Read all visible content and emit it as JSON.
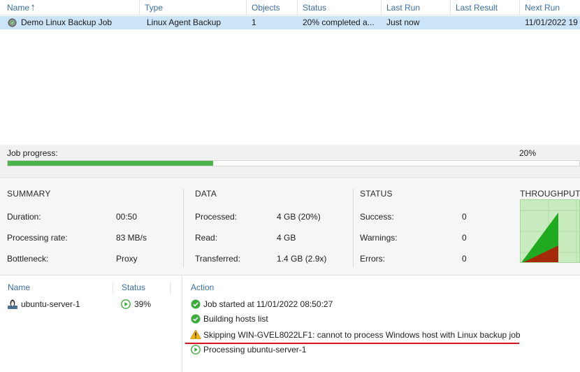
{
  "table": {
    "columns": [
      {
        "label": "Name",
        "sorted": "ascending"
      },
      {
        "label": "Type"
      },
      {
        "label": "Objects"
      },
      {
        "label": "Status"
      },
      {
        "label": "Last Run"
      },
      {
        "label": "Last Result"
      },
      {
        "label": "Next Run"
      }
    ],
    "rows": [
      {
        "name": "Demo Linux Backup Job",
        "type": "Linux Agent Backup",
        "objects": "1",
        "status": "20% completed a...",
        "last_run": "Just now",
        "last_result": "",
        "next_run": "11/01/2022 19"
      }
    ]
  },
  "progress": {
    "label": "Job progress:",
    "percent_text": "20%",
    "fraction": 0.36
  },
  "summary": {
    "title": "SUMMARY",
    "duration_label": "Duration:",
    "duration": "00:50",
    "rate_label": "Processing rate:",
    "rate": "83 MB/s",
    "bottleneck_label": "Bottleneck:",
    "bottleneck": "Proxy"
  },
  "data": {
    "title": "DATA",
    "processed_label": "Processed:",
    "processed": "4 GB (20%)",
    "read_label": "Read:",
    "read": "4 GB",
    "transferred_label": "Transferred:",
    "transferred": "1.4 GB (2.9x)"
  },
  "status": {
    "title": "STATUS",
    "success_label": "Success:",
    "success": "0",
    "warnings_label": "Warnings:",
    "warnings": "0",
    "errors_label": "Errors:",
    "errors": "0"
  },
  "throughput": {
    "title": "THROUGHPUT (L"
  },
  "objects_panel": {
    "name_header": "Name",
    "status_header": "Status",
    "items": [
      {
        "name": "ubuntu-server-1",
        "status": "39%"
      }
    ]
  },
  "actions_panel": {
    "header": "Action",
    "items": [
      {
        "icon": "success-check-icon",
        "text": "Job started at 11/01/2022 08:50:27"
      },
      {
        "icon": "success-check-icon",
        "text": "Building hosts list"
      },
      {
        "icon": "warning-icon",
        "text": "Skipping WIN-GVEL8022LF1: cannot to process Windows host with Linux backup job"
      },
      {
        "icon": "running-play-icon",
        "text": "Processing ubuntu-server-1"
      }
    ]
  },
  "colors": {
    "accent": "#3a6ea5",
    "selected_row": "#cce4f7",
    "progress": "#4cb34c",
    "warning": "#f4b400",
    "underline": "#d9141e"
  }
}
